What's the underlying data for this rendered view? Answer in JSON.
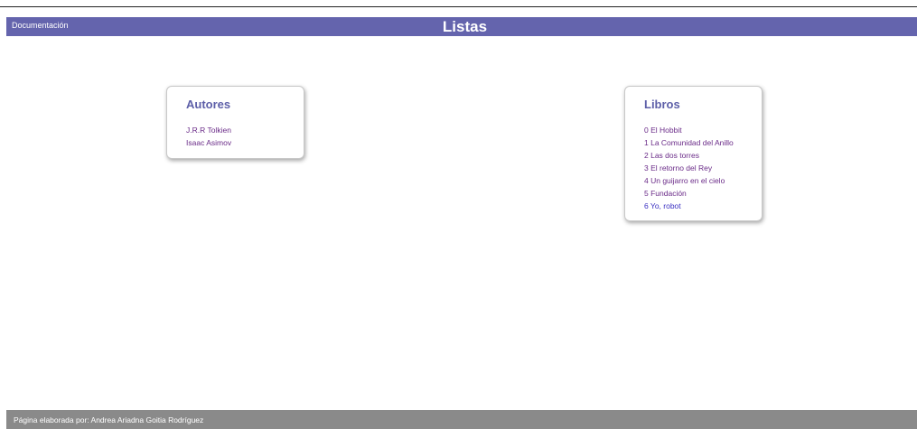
{
  "header": {
    "doc_link": "Documentación",
    "title": "Listas",
    "bg_color": "#6464ad"
  },
  "authors": {
    "title": "Autores",
    "items": [
      "J.R.R Tolkien",
      "Isaac Asimov"
    ]
  },
  "books": {
    "title": "Libros",
    "items": [
      "0 El Hobbit",
      "1 La Comunidad del Anillo",
      "2 Las dos torres",
      "3 El retorno del Rey",
      "4 Un guijarro en el cielo",
      "5 Fundación",
      "6 Yo, robot"
    ]
  },
  "footer": {
    "text": "Página elaborada por: Andrea Ariadna Goitia Rodríguez",
    "bg_color": "#8a8a8a"
  },
  "colors": {
    "card_title": "#5d5fa8",
    "link": "#6a2b88",
    "link_active": "#3b31c2"
  }
}
